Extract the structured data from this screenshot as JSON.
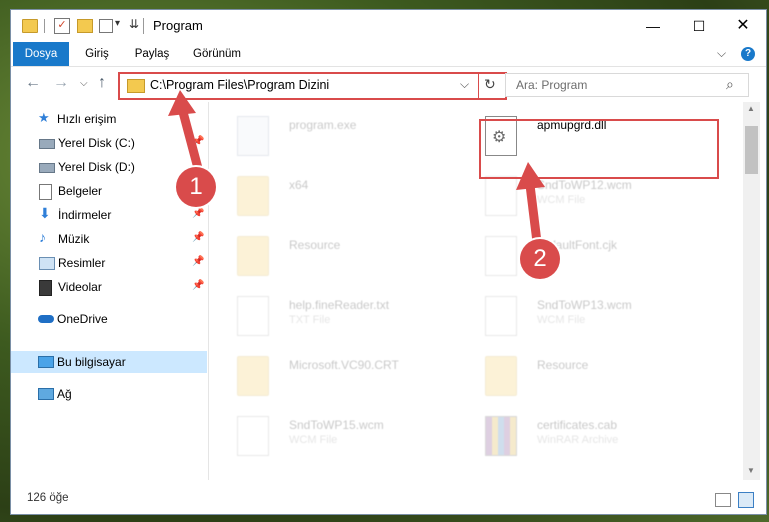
{
  "window": {
    "title": "Program",
    "controls": {
      "minimize": "—",
      "maximize": "☐",
      "close": "✕"
    }
  },
  "quick_access": {
    "dropdown_glyph": "▾",
    "arrow_glyph": "⇊"
  },
  "ribbon": {
    "tabs": [
      "Dosya",
      "Giriş",
      "Paylaş",
      "Görünüm"
    ],
    "collapse_glyph": "⌵",
    "help_glyph": "?"
  },
  "address": {
    "path": "C:\\Program Files\\Program Dizini",
    "search_placeholder": "Ara: Program",
    "refresh_glyph": "↻",
    "dropdown_glyph": "⌵"
  },
  "nav_glyphs": {
    "back": "←",
    "forward": "→",
    "recent": "⌵",
    "up": "↑"
  },
  "sidebar": {
    "quick_access": "Hızlı erişim",
    "items": [
      {
        "label": "Yerel Disk (C:)",
        "icon": "drive-icon",
        "pinned": true
      },
      {
        "label": "Yerel Disk (D:)",
        "icon": "drive-icon",
        "pinned": false
      },
      {
        "label": "Belgeler",
        "icon": "documents-icon",
        "pinned": true
      },
      {
        "label": "İndirmeler",
        "icon": "downloads-icon",
        "pinned": true
      },
      {
        "label": "Müzik",
        "icon": "music-icon",
        "pinned": true
      },
      {
        "label": "Resimler",
        "icon": "pictures-icon",
        "pinned": true
      },
      {
        "label": "Videolar",
        "icon": "videos-icon",
        "pinned": true
      }
    ],
    "onedrive": "OneDrive",
    "this_pc": "Bu bilgisayar",
    "network": "Ağ",
    "pin_glyph": "📌"
  },
  "files": [
    {
      "name": "program.exe",
      "type": "",
      "icon": "exe-icon",
      "faded": true
    },
    {
      "name": "apmupgrd.dll",
      "type": "",
      "icon": "dll-icon",
      "faded": false
    },
    {
      "name": "x64",
      "type": "",
      "icon": "folder-icon",
      "faded": true
    },
    {
      "name": "SndToWP12.wcm",
      "type": "WCM File",
      "icon": "document-icon",
      "faded": true
    },
    {
      "name": "Resource",
      "type": "",
      "icon": "folder-icon",
      "faded": true
    },
    {
      "name": "DefaultFont.cjk",
      "type": "",
      "icon": "document-icon",
      "faded": true
    },
    {
      "name": "help.fineReader.txt",
      "type": "TXT File",
      "icon": "document-icon",
      "faded": true
    },
    {
      "name": "SndToWP13.wcm",
      "type": "WCM File",
      "icon": "document-icon",
      "faded": true
    },
    {
      "name": "Microsoft.VC90.CRT",
      "type": "",
      "icon": "folder-icon",
      "faded": true
    },
    {
      "name": "Resource",
      "type": "",
      "icon": "folder-icon",
      "faded": true
    },
    {
      "name": "SndToWP15.wcm",
      "type": "WCM File",
      "icon": "document-icon",
      "faded": true
    },
    {
      "name": "certificates.cab",
      "type": "WinRAR Archive",
      "icon": "archive-icon",
      "faded": true
    }
  ],
  "status": {
    "item_count": "126 öğe"
  },
  "markers": {
    "one": "1",
    "two": "2"
  },
  "colors": {
    "accent": "#1979ca",
    "highlight": "#d94b4b",
    "selected_nav": "#cce8ff"
  }
}
